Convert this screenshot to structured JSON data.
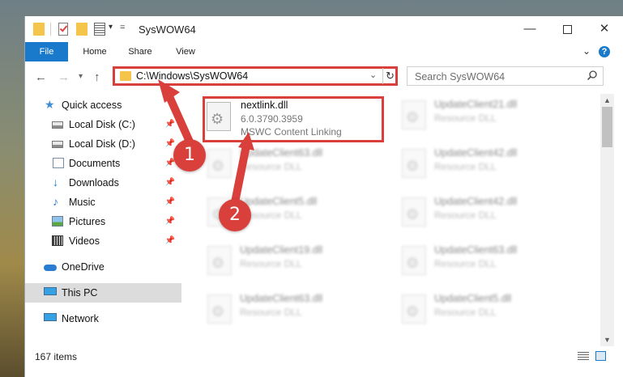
{
  "window": {
    "title": "SysWOW64"
  },
  "ribbon": {
    "tabs": [
      "File",
      "Home",
      "Share",
      "View"
    ]
  },
  "address": {
    "path": "C:\\Windows\\SysWOW64"
  },
  "search": {
    "placeholder": "Search SysWOW64"
  },
  "sidebar": {
    "items": [
      {
        "label": "Quick access",
        "icon": "star-icon"
      },
      {
        "label": "Local Disk (C:)",
        "icon": "drive-icon",
        "pinned": true
      },
      {
        "label": "Local Disk (D:)",
        "icon": "drive-icon",
        "pinned": true
      },
      {
        "label": "Documents",
        "icon": "document-icon",
        "pinned": true
      },
      {
        "label": "Downloads",
        "icon": "download-icon",
        "pinned": true
      },
      {
        "label": "Music",
        "icon": "music-icon",
        "pinned": true
      },
      {
        "label": "Pictures",
        "icon": "pictures-icon",
        "pinned": true
      },
      {
        "label": "Videos",
        "icon": "video-icon",
        "pinned": true
      },
      {
        "label": "OneDrive",
        "icon": "onedrive-icon"
      },
      {
        "label": "This PC",
        "icon": "computer-icon",
        "selected": true
      },
      {
        "label": "Network",
        "icon": "network-icon"
      }
    ]
  },
  "files": {
    "focused": {
      "name": "nextlink.dll",
      "version": "6.0.3790.3959",
      "description": "MSWC Content Linking"
    },
    "left": [
      {
        "name": "UpdateClient63.dll",
        "type": "Resource DLL"
      },
      {
        "name": "UpdateClient5.dll",
        "type": "Resource DLL"
      },
      {
        "name": "UpdateClient19.dll",
        "type": "Resource DLL"
      },
      {
        "name": "UpdateClient63.dll",
        "type": "Resource DLL"
      }
    ],
    "right": [
      {
        "name": "UpdateClient21.dll",
        "type": "Resource DLL"
      },
      {
        "name": "UpdateClient42.dll",
        "type": "Resource DLL"
      },
      {
        "name": "UpdateClient42.dll",
        "type": "Resource DLL"
      },
      {
        "name": "UpdateClient63.dll",
        "type": "Resource DLL"
      },
      {
        "name": "UpdateClient5.dll",
        "type": "Resource DLL"
      }
    ]
  },
  "status": {
    "count": "167 items"
  },
  "callouts": {
    "one": "1",
    "two": "2"
  },
  "colors": {
    "accent": "#1979ca",
    "highlight": "#d9403b"
  }
}
